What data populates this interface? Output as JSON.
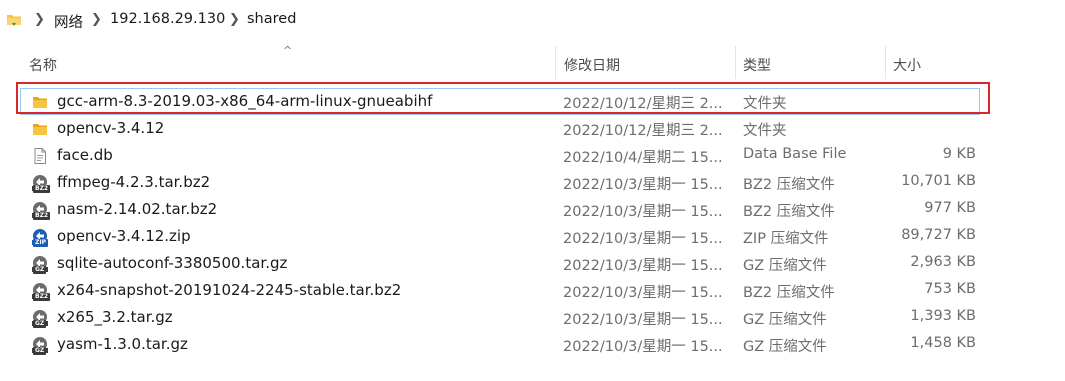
{
  "breadcrumb": {
    "items": [
      "网络",
      "192.168.29.130",
      "shared"
    ]
  },
  "columns": {
    "name": "名称",
    "modified": "修改日期",
    "type": "类型",
    "size": "大小"
  },
  "files": [
    {
      "name": "gcc-arm-8.3-2019.03-x86_64-arm-linux-gnueabihf",
      "modified": "2022/10/12/星期三 2...",
      "type": "文件夹",
      "size": "",
      "icon": "folder-icon"
    },
    {
      "name": "opencv-3.4.12",
      "modified": "2022/10/12/星期三 2...",
      "type": "文件夹",
      "size": "",
      "icon": "folder-icon"
    },
    {
      "name": "face.db",
      "modified": "2022/10/4/星期二 15...",
      "type": "Data Base File",
      "size": "9 KB",
      "icon": "document-icon"
    },
    {
      "name": "ffmpeg-4.2.3.tar.bz2",
      "modified": "2022/10/3/星期一 15...",
      "type": "BZ2 压缩文件",
      "size": "10,701 KB",
      "icon": "archive-icon",
      "badge": "BZ2"
    },
    {
      "name": "nasm-2.14.02.tar.bz2",
      "modified": "2022/10/3/星期一 15...",
      "type": "BZ2 压缩文件",
      "size": "977 KB",
      "icon": "archive-icon",
      "badge": "BZ2"
    },
    {
      "name": "opencv-3.4.12.zip",
      "modified": "2022/10/3/星期一 15...",
      "type": "ZIP 压缩文件",
      "size": "89,727 KB",
      "icon": "archive-icon",
      "badge": "ZIP"
    },
    {
      "name": "sqlite-autoconf-3380500.tar.gz",
      "modified": "2022/10/3/星期一 15...",
      "type": "GZ 压缩文件",
      "size": "2,963 KB",
      "icon": "archive-icon",
      "badge": "GZ"
    },
    {
      "name": "x264-snapshot-20191024-2245-stable.tar.bz2",
      "modified": "2022/10/3/星期一 15...",
      "type": "BZ2 压缩文件",
      "size": "753 KB",
      "icon": "archive-icon",
      "badge": "BZ2"
    },
    {
      "name": "x265_3.2.tar.gz",
      "modified": "2022/10/3/星期一 15...",
      "type": "GZ 压缩文件",
      "size": "1,393 KB",
      "icon": "archive-icon",
      "badge": "GZ"
    },
    {
      "name": "yasm-1.3.0.tar.gz",
      "modified": "2022/10/3/星期一 15...",
      "type": "GZ 压缩文件",
      "size": "1,458 KB",
      "icon": "archive-icon",
      "badge": "GZ"
    }
  ],
  "colors": {
    "highlight_border": "#d9262b",
    "folder_yellow": "#f5c542",
    "zip_blue": "#1a5fb4"
  }
}
